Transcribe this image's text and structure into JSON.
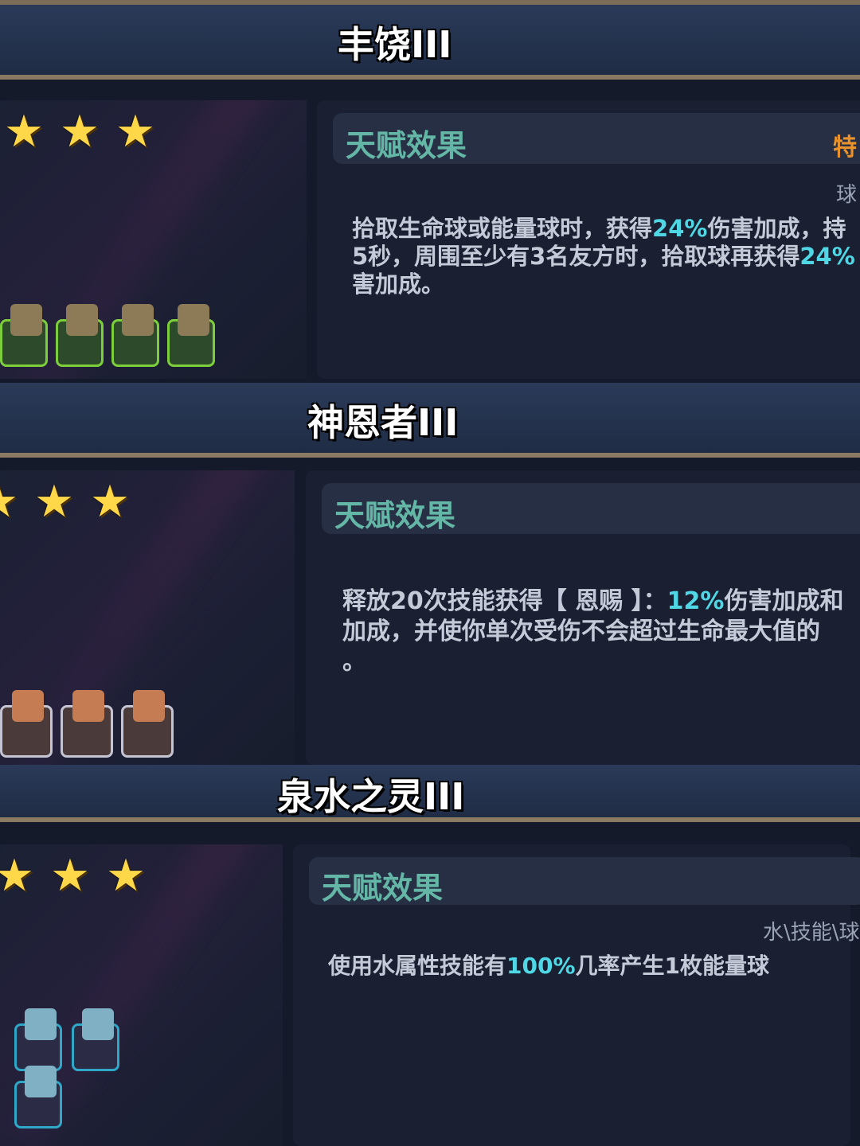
{
  "sections": [
    {
      "title": "丰饶III",
      "stars": 3,
      "effect_title": "天赋效果",
      "tag": "特",
      "note": "球",
      "desc_lines": [
        [
          "拾取生命球或能量球时，获得",
          "24%",
          "伤害加成，持"
        ],
        [
          "5秒，周围至少有3名友方时，拾取球再获得",
          "24%",
          ""
        ],
        [
          "害加成。",
          "",
          ""
        ]
      ],
      "heroes": 4,
      "hero_color": "#7ccf3b"
    },
    {
      "title": "神恩者III",
      "stars": 3,
      "effect_title": "天赋效果",
      "desc_lines": [
        [
          "释放20次技能获得【 恩赐 】：",
          "12%",
          "伤害加成和"
        ],
        [
          "加成，并使你单次受伤不会超过生命最大值的",
          "",
          ""
        ],
        [
          "。",
          "",
          ""
        ]
      ],
      "heroes": 3,
      "hero_color": "#b9b9c9"
    },
    {
      "title": "泉水之灵III",
      "stars": 3,
      "effect_title": "天赋效果",
      "note": "水\\技能\\球",
      "desc_lines": [
        [
          "使用水属性技能有",
          "100%",
          "几率产生1枚能量球"
        ]
      ],
      "heroes": 3,
      "hero_color": "#2fa8c8"
    }
  ]
}
